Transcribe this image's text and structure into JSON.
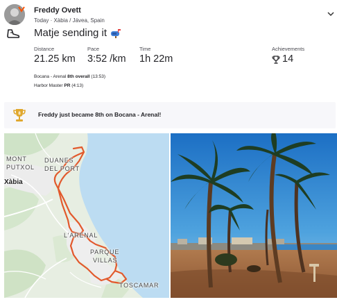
{
  "athlete": {
    "name": "Freddy Ovett"
  },
  "activity": {
    "meta": "Today · Xàbia / Jávea, Spain",
    "title": "Matje sending it",
    "title_emoji_icon": "mailbox-icon",
    "sport_icon": "shoe-icon"
  },
  "stats": [
    {
      "label": "Distance",
      "value": "21.25 km"
    },
    {
      "label": "Pace",
      "value": "3:52 /km"
    },
    {
      "label": "Time",
      "value": "1h 22m"
    }
  ],
  "achievements": {
    "label": "Achievements",
    "count": "14",
    "icon": "trophy-icon"
  },
  "segments": [
    {
      "name": "Bocana - Arenal",
      "highlight": "8th overall",
      "detail": "(13:53)"
    },
    {
      "name": "Harbor Master",
      "highlight": "PR",
      "detail": "(4:13)"
    }
  ],
  "banner": {
    "text": "Freddy just became 8th on Bocana - Arenal!",
    "icon": "trophy-icon"
  },
  "map": {
    "labels": {
      "montgo_1": "MONT",
      "montgo_2": "PUTXOL",
      "duanes_1": "DUANES",
      "duanes_2": "DEL PORT",
      "xabia": "Xàbia",
      "arenal": "L'ARENAL",
      "parque_1": "PARQUE",
      "parque_2": "VILLAS",
      "tosca": "TOSCAMAR"
    },
    "route_color": "#e2592c"
  },
  "photo": {
    "subject": "palm trees on beach"
  },
  "colors": {
    "brand": "#fc5200",
    "trophy_gold": "#e0a82e"
  }
}
